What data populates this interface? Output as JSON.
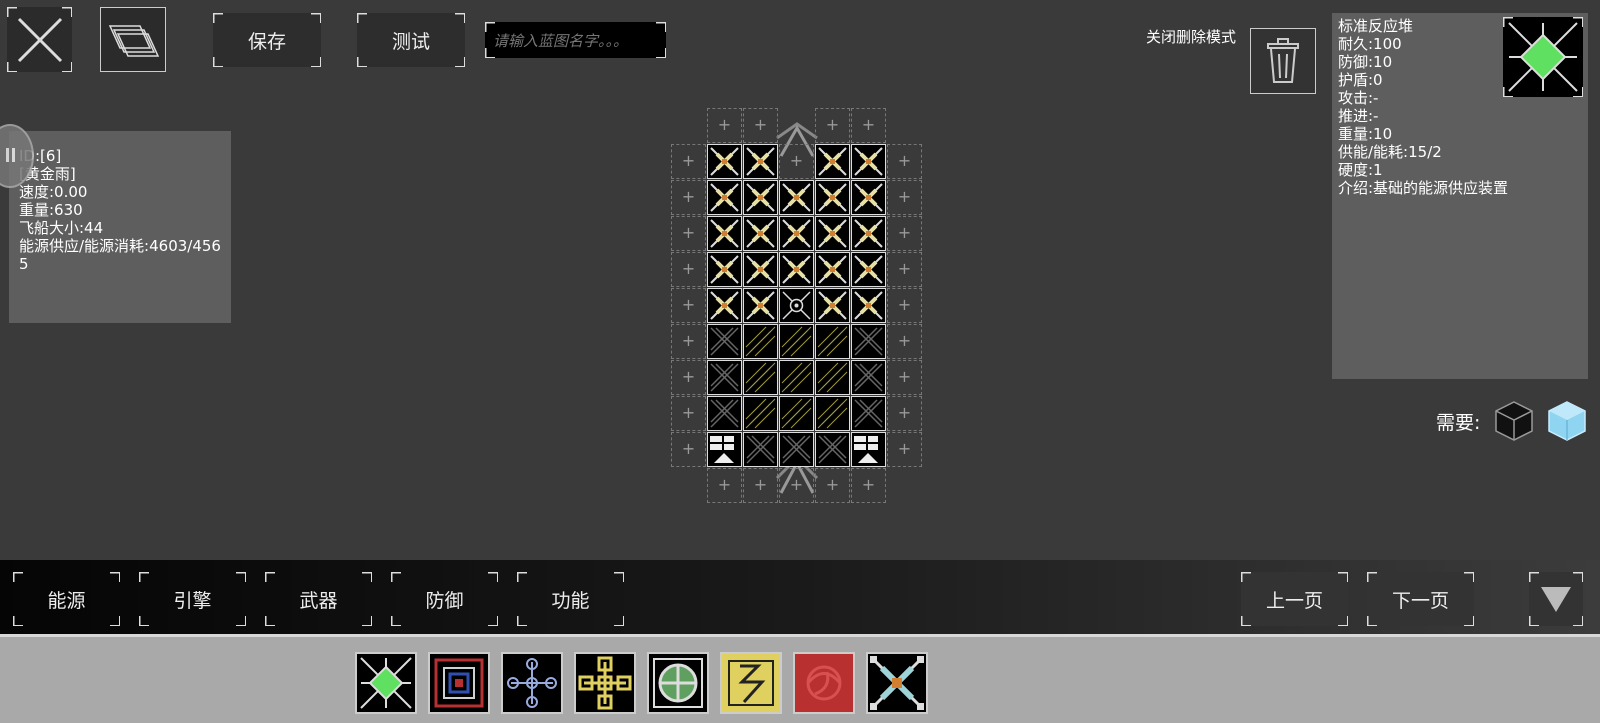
{
  "toolbar": {
    "save_label": "保存",
    "test_label": "测试",
    "name_placeholder": "请输入蓝图名字。。。"
  },
  "delete_mode_label": "关闭删除模式",
  "ship_info": {
    "lines": [
      "ID:[6]",
      "[黄金雨]",
      "速度:0.00",
      "重量:630",
      "飞船大小:44",
      "能源供应/能源消耗:4603/4565"
    ]
  },
  "part_info": {
    "lines": [
      "标准反应堆",
      "耐久:100",
      "防御:10",
      "护盾:0",
      "攻击:-",
      "推进:-",
      "重量:10",
      "供能/能耗:15/2",
      "硬度:1",
      "介绍:基础的能源供应装置"
    ]
  },
  "requires_label": "需要:",
  "categories": [
    "能源",
    "引擎",
    "武器",
    "防御",
    "功能"
  ],
  "pager": {
    "prev": "上一页",
    "next": "下一页"
  },
  "palette": [
    "reactor-part-icon",
    "armor-part-icon",
    "cyan-node-part-icon",
    "yellow-node-part-icon",
    "shield-part-icon",
    "lightning-part-icon",
    "red-swirl-part-icon",
    "x-reactor-part-icon"
  ],
  "colors": {
    "accent_green": "#5fe060",
    "energy_yellow": "#e0d060",
    "slot_red": "#b83030"
  }
}
